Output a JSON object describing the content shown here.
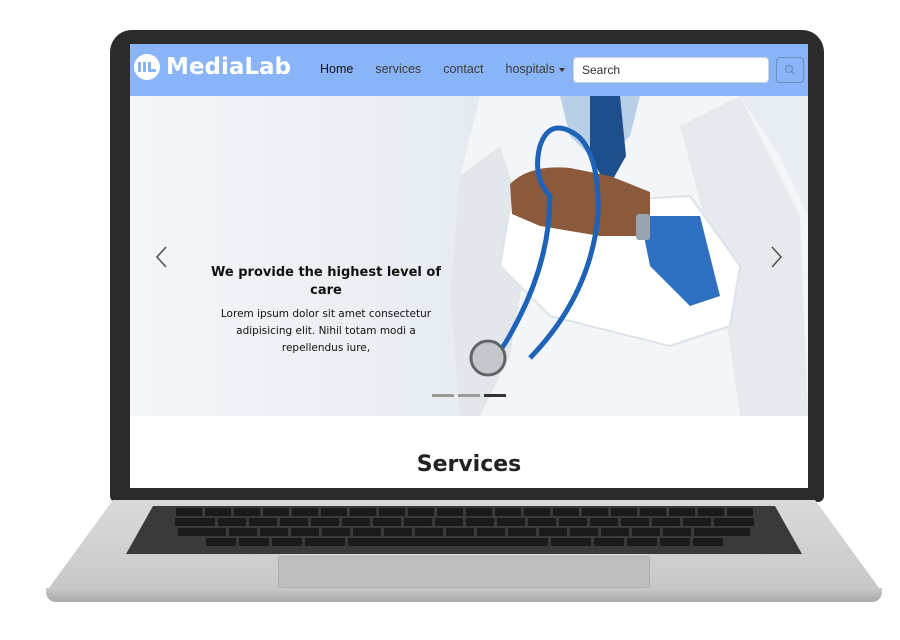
{
  "navbar": {
    "brand": "MediaLab",
    "links": [
      "Home",
      "services",
      "contact",
      "hospitals"
    ],
    "search_placeholder": "Search"
  },
  "hero": {
    "title": "We provide the highest level of care",
    "text": "Lorem ipsum dolor sit amet consectetur adipisicing elit. Nihil totam modi a repellendus iure,",
    "indicators": {
      "count": 3,
      "active": 3
    }
  },
  "services": {
    "title": "Services"
  },
  "icons": {
    "logo": "medialab-logo-icon",
    "search": "search-icon",
    "prev": "chevron-left-icon",
    "next": "chevron-right-icon",
    "dropdown": "caret-down-icon"
  },
  "colors": {
    "navbar_bg": "#8ab4f8",
    "brand_text": "#ffffff",
    "laptop_bezel": "#2b2b2b"
  }
}
